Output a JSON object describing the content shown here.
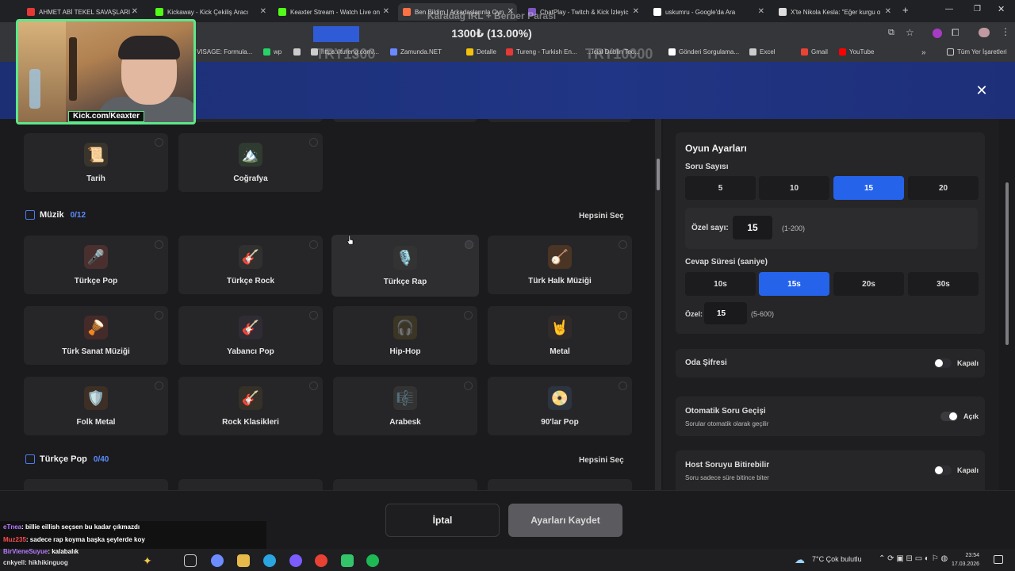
{
  "browser": {
    "tabs": [
      {
        "title": "AHMET ABİ TEKEL SAVAŞLARI - ",
        "color": "#e53935"
      },
      {
        "title": "Kickaway - Kick Çekiliş Aracı",
        "color": "#53fc18"
      },
      {
        "title": "Keaxter Stream - Watch Live on",
        "color": "#53fc18"
      },
      {
        "title": "Ben Bildim | Arkadaşlarınla Oyn",
        "color": "#ff7043"
      },
      {
        "title": "ChatPlay - Twitch & Kick İzleyic",
        "color": "#7e57c2"
      },
      {
        "title": "uskumru - Google'da Ara",
        "color": "#ffffff"
      },
      {
        "title": "X'te Nikola Kesla: \"Eğer kurgu o",
        "color": "#dddddd"
      }
    ],
    "bookmarks": [
      {
        "label": "VISAGE: Formula...",
        "color": "#888888"
      },
      {
        "label": "wp",
        "color": "#25d366"
      },
      {
        "label": "https://tureng.com/...",
        "color": "#cccccc"
      },
      {
        "label": "Zamunda.NET",
        "color": "#6a89ff"
      },
      {
        "label": "Detalle",
        "color": "#f4c20d"
      },
      {
        "label": "Tureng - Turkish En...",
        "color": "#e53935"
      },
      {
        "label": "...icial Dublin Teo...",
        "color": "#e53935"
      },
      {
        "label": "Gönderi Sorgulama...",
        "color": "#ffffff"
      },
      {
        "label": "Excel",
        "color": "#cccccc"
      },
      {
        "label": "Gmail",
        "color": "#ea4335"
      },
      {
        "label": "YouTube",
        "color": "#ff0000"
      }
    ],
    "all_bookmarks": "Tüm Yer İşaretleri",
    "more_bookmarks": "»"
  },
  "stream_overlay": {
    "title": "Karadağ IRL + Berber Parası",
    "donation_progress": "1300₺ (13.00%)",
    "donation_fraction": 0.13,
    "ghost_left": "TRY1300",
    "ghost_right": "TRY10000",
    "webcam_label": "Kick.com/Keaxter"
  },
  "modal": {
    "close_icon": "✕"
  },
  "categories": {
    "top_cards": [
      {
        "label": "Tarih",
        "emoji": "📜",
        "color": "#3a352c"
      },
      {
        "label": "Coğrafya",
        "emoji": "🏔️",
        "color": "#2f3a30"
      }
    ],
    "music_section": {
      "title": "Müzik",
      "count": "0/12",
      "select_all": "Hepsini Seç",
      "cards": [
        {
          "label": "Türkçe Pop",
          "emoji": "🎤",
          "color": "#4a2f2f"
        },
        {
          "label": "Türkçe Rock",
          "emoji": "🎸",
          "color": "#303030"
        },
        {
          "label": "Türkçe Rap",
          "emoji": "🎙️",
          "color": "#333333"
        },
        {
          "label": "Türk Halk Müziği",
          "emoji": "🪕",
          "color": "#4a3424"
        },
        {
          "label": "Türk Sanat Müziği",
          "emoji": "🪘",
          "color": "#452a2a"
        },
        {
          "label": "Yabancı Pop",
          "emoji": "🎸",
          "color": "#302c34"
        },
        {
          "label": "Hip-Hop",
          "emoji": "🎧",
          "color": "#3a3525"
        },
        {
          "label": "Metal",
          "emoji": "🤘",
          "color": "#302a2a"
        },
        {
          "label": "Folk Metal",
          "emoji": "🛡️",
          "color": "#3d2f25"
        },
        {
          "label": "Rock Klasikleri",
          "emoji": "🎸",
          "color": "#353028"
        },
        {
          "label": "Arabesk",
          "emoji": "🎼",
          "color": "#333333"
        },
        {
          "label": "90'lar Pop",
          "emoji": "📀",
          "color": "#2c3440"
        }
      ]
    },
    "turkce_pop_section": {
      "title": "Türkçe Pop",
      "count": "0/40",
      "select_all": "Hepsini Seç"
    }
  },
  "settings": {
    "title": "Oyun Ayarları",
    "question_count": {
      "label": "Soru Sayısı",
      "options": [
        "5",
        "10",
        "15",
        "20"
      ],
      "selected": "15",
      "custom_label": "Özel sayı:",
      "custom_value": "15",
      "custom_hint": "(1-200)"
    },
    "answer_time": {
      "label": "Cevap Süresi (saniye)",
      "options": [
        "10s",
        "15s",
        "20s",
        "30s"
      ],
      "selected": "15s",
      "custom_label": "Özel:",
      "custom_value": "15",
      "custom_hint": "(5-600)"
    },
    "room_password": {
      "label": "Oda Şifresi",
      "state": "Kapalı",
      "on": false
    },
    "auto_next": {
      "label": "Otomatik Soru Geçişi",
      "sub": "Sorular otomatik olarak geçilir",
      "state": "Açık",
      "on": true
    },
    "host_finish": {
      "label": "Host Soruyu Bitirebilir",
      "sub": "Soru sadece süre bitince biter",
      "state": "Kapalı",
      "on": false
    }
  },
  "footer": {
    "cancel": "İptal",
    "save": "Ayarları Kaydet"
  },
  "chat": [
    {
      "user": "eTnea",
      "message": ": billie eillish seçsen bu kadar çıkmazdı"
    },
    {
      "user": "Muz235",
      "message": ": sadece rap koyma başka şeylerde koy"
    },
    {
      "user": "BirVieneSuyue",
      "message": ": kalabalık"
    },
    {
      "user": "cnkyell",
      "message": ": hikhikinguog"
    }
  ],
  "taskbar": {
    "weather": "7°C  Çok bulutlu",
    "time": "23:54",
    "date": "17.03.2026"
  }
}
